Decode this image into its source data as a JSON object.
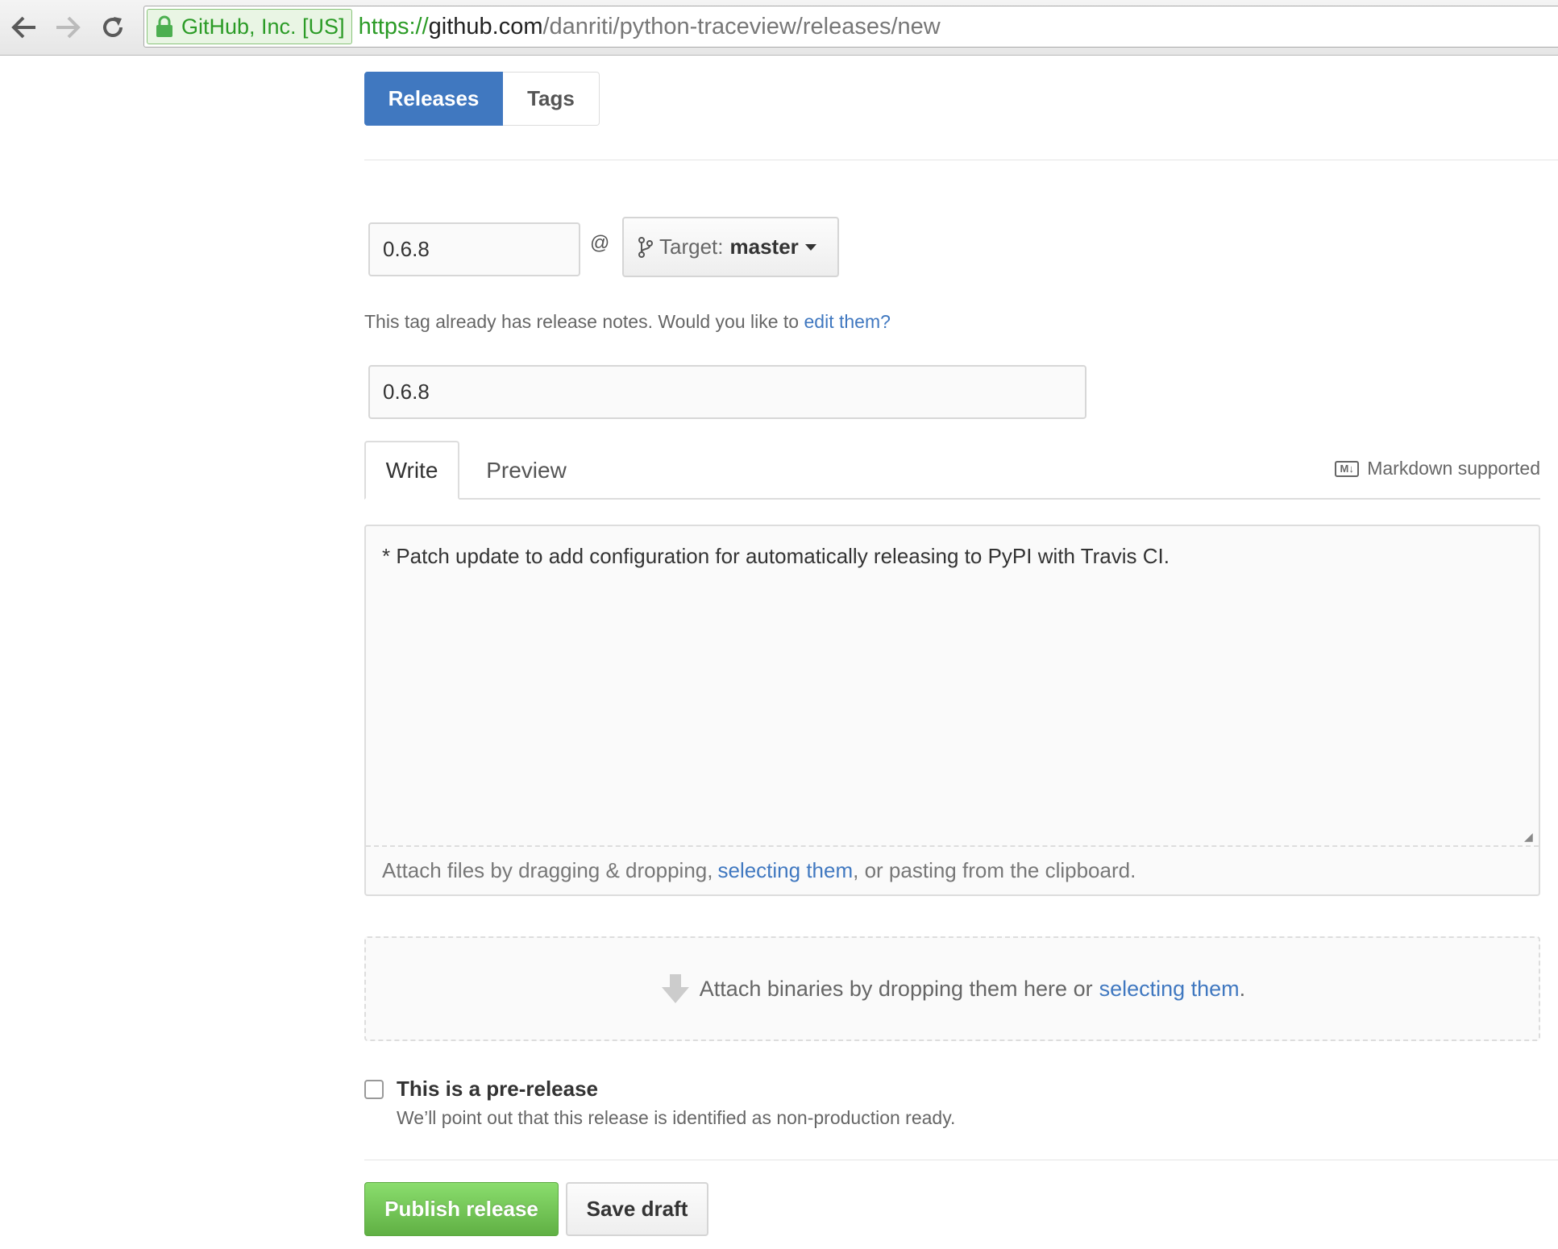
{
  "browser": {
    "back_icon": "arrow-left-icon",
    "forward_icon": "arrow-right-icon",
    "reload_icon": "reload-icon",
    "ev_label": "GitHub, Inc. [US]",
    "url_scheme": "https://",
    "url_host": "github.com",
    "url_path": "/danriti/python-traceview/releases/new"
  },
  "subnav": {
    "releases_label": "Releases",
    "tags_label": "Tags"
  },
  "form": {
    "tag_value": "0.6.8",
    "at_symbol": "@",
    "target_prefix": "Target:",
    "target_branch": "master",
    "notice_text": "This tag already has release notes. Would you like to ",
    "notice_link": "edit them?",
    "title_value": "0.6.8"
  },
  "editor": {
    "write_tab": "Write",
    "preview_tab": "Preview",
    "markdown_badge": "M↓",
    "markdown_note": "Markdown supported",
    "body_text": "* Patch update to add configuration for automatically releasing to PyPI with Travis CI.",
    "attach_prefix": "Attach files by dragging & dropping, ",
    "attach_link": "selecting them",
    "attach_suffix": ", or pasting from the clipboard."
  },
  "binaries": {
    "text": "Attach binaries by dropping them here or ",
    "link": "selecting them",
    "suffix": "."
  },
  "prerelease": {
    "label": "This is a pre-release",
    "help": "We’ll point out that this release is identified as non-production ready.",
    "checked": false
  },
  "actions": {
    "publish_label": "Publish release",
    "draft_label": "Save draft"
  },
  "colors": {
    "accent": "#4078c0",
    "primary_button": "#60b044",
    "ev_green": "#2b9b26"
  }
}
